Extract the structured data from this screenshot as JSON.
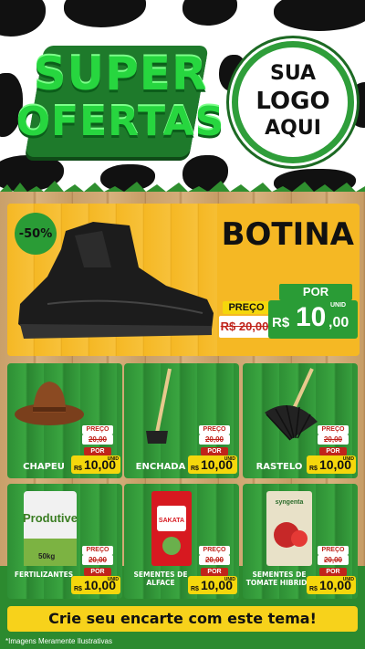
{
  "header": {
    "title_line1": "SUPER",
    "title_line2": "OFERTAS",
    "logo_line1": "SUA",
    "logo_line2": "LOGO",
    "logo_line3": "AQUI"
  },
  "featured": {
    "discount": "-50%",
    "name": "BOTINA",
    "old_label": "PREÇO",
    "old_price": "R$ 20,00",
    "new_label": "POR",
    "new_price_prefix": "R$",
    "new_price_int": "10",
    "new_price_dec": ",00",
    "unit": "UNID"
  },
  "products": [
    {
      "name": "CHAPEU",
      "old_label": "PREÇO",
      "old_price": "20,00",
      "new_label": "POR",
      "prefix": "R$",
      "price": "10,00",
      "unit": "UNID"
    },
    {
      "name": "ENCHADA",
      "old_label": "PREÇO",
      "old_price": "20,00",
      "new_label": "POR",
      "prefix": "R$",
      "price": "10,00",
      "unit": "UNID"
    },
    {
      "name": "RASTELO",
      "old_label": "PREÇO",
      "old_price": "20,00",
      "new_label": "POR",
      "prefix": "R$",
      "price": "10,00",
      "unit": "UNID"
    },
    {
      "name": "FERTILIZANTES",
      "old_label": "PREÇO",
      "old_price": "20,00",
      "new_label": "POR",
      "prefix": "R$",
      "price": "10,00",
      "unit": "UNID",
      "bag_brand": "Produtive",
      "bag_weight": "50kg"
    },
    {
      "name": "SEMENTES DE ALFACE",
      "old_label": "PREÇO",
      "old_price": "20,00",
      "new_label": "POR",
      "prefix": "R$",
      "price": "10,00",
      "unit": "UNID",
      "pack_brand": "SAKATA"
    },
    {
      "name": "SEMENTES DE TOMATE HIBRIDA",
      "old_label": "PREÇO",
      "old_price": "20,00",
      "new_label": "POR",
      "prefix": "R$",
      "price": "10,00",
      "unit": "UNID",
      "pack_brand": "syngenta"
    }
  ],
  "cta": "Crie seu encarte com este tema!",
  "footnote": "*Imagens Meramente Ilustrativas",
  "colors": {
    "green": "#2a9c36",
    "yellow": "#f5b824",
    "price_yellow": "#f5d70c",
    "red": "#c0241b"
  }
}
